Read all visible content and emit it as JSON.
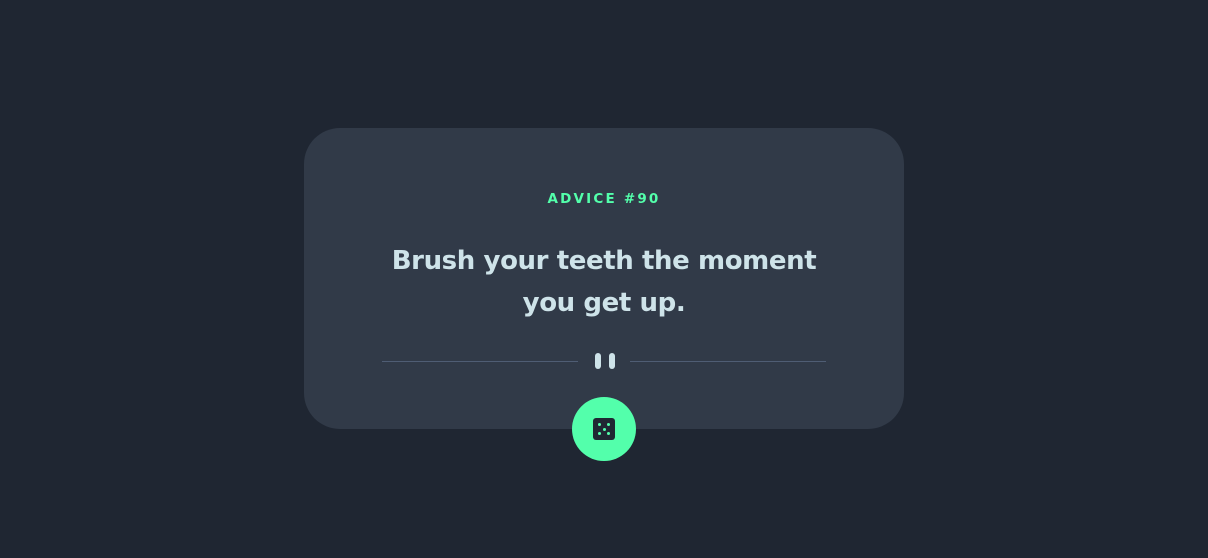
{
  "advice": {
    "label": "ADVICE #90",
    "text": "Brush your teeth the moment you get up."
  },
  "icons": {
    "divider": "pause-icon",
    "button": "dice-icon"
  },
  "colors": {
    "background": "#1f2632",
    "card": "#313a48",
    "accent": "#53ffab",
    "text": "#cee3e9",
    "divider": "#4f5d74"
  }
}
